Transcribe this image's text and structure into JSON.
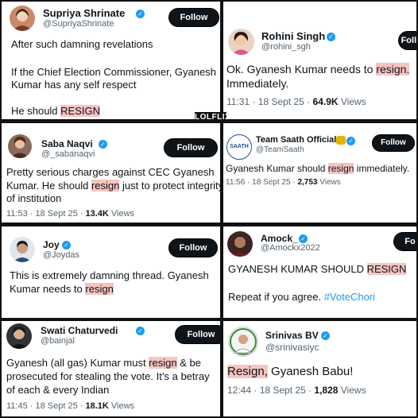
{
  "watermark": "LOLFLIX",
  "tweets": [
    {
      "name": "Supriya Shrinate",
      "handle": "@SupriyaShrinate",
      "follow": "Follow",
      "line1": "After such damning revelations",
      "line2": "If the Chief Election Commissioner, Gyanesh",
      "line3": "Kumar has any self respect",
      "line4_pre": "He should ",
      "line4_hl": "RESIGN"
    },
    {
      "name": "Rohini Singh",
      "handle": "@rohini_sgh",
      "follow": "Follow",
      "line1_pre": "Ok. Gyanesh Kumar needs to ",
      "line1_hl": "resign.",
      "line2": "Immediately.",
      "time": "11:31 · 18 Sept 25 · ",
      "views_num": "64.9K",
      "views_label": " Views"
    },
    {
      "name": "Saba Naqvi",
      "handle": "@_sabanaqvi",
      "follow": "Follow",
      "line1": "Pretty serious charges against CEC Gyanesh",
      "line2_pre": "Kumar. He should ",
      "line2_hl": "resign",
      "line2_post": " just to protect integrity",
      "line3": "of institution",
      "time": "11:53 · 18 Sept 25 · ",
      "views_num": "13.4K",
      "views_label": " Views"
    },
    {
      "name": "Team Saath Official",
      "handle": "@TeamSaath",
      "follow": "Follow",
      "avatar_text": "SAATH",
      "line1_pre": "Gyanesh Kumar should ",
      "line1_hl": "resign",
      "line1_post": " immediately.",
      "time": "11:56 · 18 Sept 25 · ",
      "views_num": "2,753",
      "views_label": " Views"
    },
    {
      "name": "Joy",
      "handle": "@Joydas",
      "follow": "Follow",
      "line1": "This is extremely damning thread. Gyanesh",
      "line2_pre": "Kumar needs to ",
      "line2_hl": "resign"
    },
    {
      "name": "Amock_",
      "handle": "@Amockx2022",
      "follow": "Fo",
      "line1_pre": "GYANESH KUMAR SHOULD ",
      "line1_hl": "RESIGN",
      "line2_pre": "Repeat if you agree. ",
      "line2_tag": "#VoteChori"
    },
    {
      "name": "Swati Chaturvedi",
      "handle": "@bainjal",
      "follow": "Follow",
      "line1_pre": "Gyanesh (all gas) Kumar must ",
      "line1_hl": "resign",
      "line1_post": " & be",
      "line2": "prosecuted for stealing the vote. It’s a betray",
      "line3": "of each & every Indian",
      "time": "11:45 · 18 Sept 25 · ",
      "views_num": "18.1K",
      "views_label": " Views"
    },
    {
      "name": "Srinivas BV",
      "handle": "@srinivasiyc",
      "line1_hl": "Resign,",
      "line1_post": " Gyanesh Babu!",
      "time": "12:44 · 18 Sept 25 · ",
      "views_num": "1,828",
      "views_label": " Views"
    }
  ]
}
